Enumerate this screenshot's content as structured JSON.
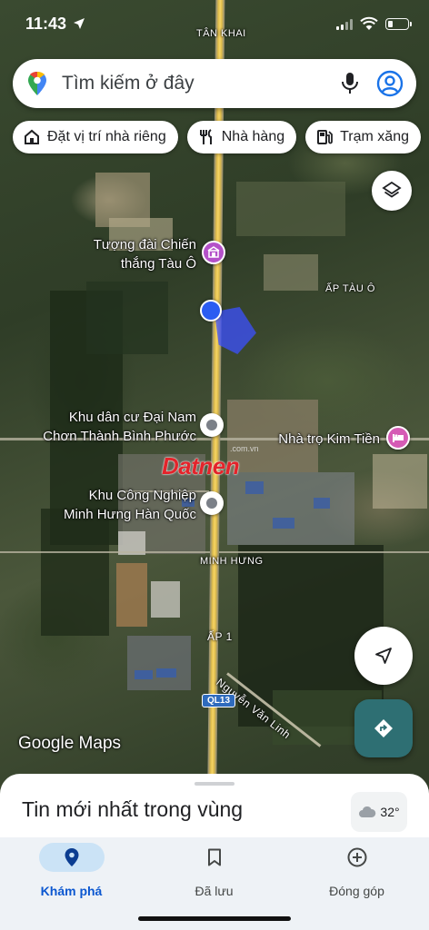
{
  "status_bar": {
    "time": "11:43"
  },
  "search": {
    "placeholder": "Tìm kiếm ở đây"
  },
  "chips": [
    {
      "label": "Đặt vị trí nhà riêng",
      "icon": "home-icon"
    },
    {
      "label": "Nhà hàng",
      "icon": "restaurant-icon"
    },
    {
      "label": "Trạm xăng",
      "icon": "gas-station-icon"
    }
  ],
  "map": {
    "top_label": "TÂN KHAI",
    "area_labels": {
      "ap_tau_o": "ẤP TÀU Ô",
      "minh_hung": "MINH HƯNG",
      "ap_1": "ẤP 1"
    },
    "places": {
      "tuong_dai": [
        "Tượng đài Chiến",
        "thắng Tàu Ô"
      ],
      "khu_dan_cu": [
        "Khu dân cư Đại Nam",
        "Chơn Thành Bình Phước"
      ],
      "khu_cong_nghiep": [
        "Khu Công Nghiệp",
        "Minh Hưng Hàn Quốc"
      ],
      "nha_tro": "Nhà trọ Kim Tiền"
    },
    "street": "Nguyễn Văn Linh",
    "highway_shield": "QL13",
    "watermark": "Datnen",
    "watermark_sub": ".com.vn",
    "attribution": "Google Maps"
  },
  "sheet": {
    "title": "Tin mới nhất trong vùng",
    "temperature": "32°"
  },
  "nav": [
    {
      "label": "Khám phá",
      "icon": "explore-pin-icon",
      "active": true
    },
    {
      "label": "Đã lưu",
      "icon": "bookmark-icon",
      "active": false
    },
    {
      "label": "Đóng góp",
      "icon": "add-circle-icon",
      "active": false
    }
  ],
  "colors": {
    "accent": "#0b57d0",
    "user_location": "#2b5cf2",
    "directions_button": "#2e6f73",
    "landmark_pin": "#b451c9"
  }
}
